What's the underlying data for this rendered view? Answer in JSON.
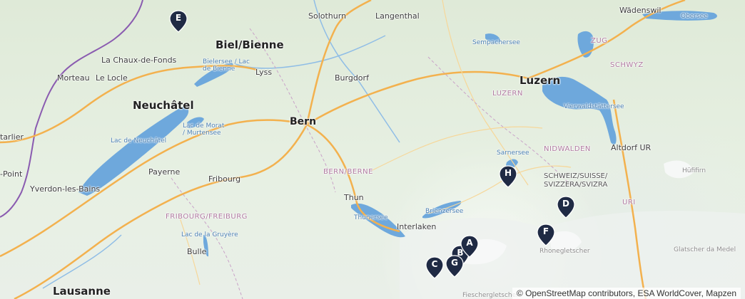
{
  "map": {
    "places": {
      "solothurn": "Solothurn",
      "langenthal": "Langenthal",
      "wadenswil": "Wädenswil",
      "obersee": "Obersee",
      "biel": "Biel/Bienne",
      "chaux": "La Chaux-de-Fonds",
      "morteau": "Morteau",
      "locle": "Le Locle",
      "bielersee": "Bielersee / Lac de Bienne",
      "lyss": "Lyss",
      "burgdorf": "Burgdorf",
      "sempachersee": "Sempachersee",
      "zug": "ZUG",
      "luzern_city": "Luzern",
      "luzern_canton": "LUZERN",
      "schwyz": "SCHWYZ",
      "neuchatel": "Neuchâtel",
      "pontarlier": "tarlier",
      "lacmorat": "Lac de Morat / Murtensee",
      "bern": "Bern",
      "vierwald": "Vierwaldstättersee",
      "lacneuchatel": "Lac de Neuchâtel",
      "payerne": "Payerne",
      "sarnersee": "Sarnersee",
      "nidwalden": "NIDWALDEN",
      "altdorf": "Altdorf UR",
      "bernberne": "BERN/BERNE",
      "point": "-Point",
      "yverdon": "Yverdon-les-Bains",
      "fribourg": "Fribourg",
      "schweiz": "SCHWEIZ/SUISSE/ SVIZZERA/SVIZRA",
      "huefifirn": "Hüfifirn",
      "thun": "Thun",
      "brienzersee": "Brienzersee",
      "uri": "URI",
      "thunersee": "Thunersee",
      "fribourg_canton": "FRIBOURG/FREIBURG",
      "interlaken": "Interlaken",
      "lacgruyere": "Lac de la Gruyère",
      "rhonegletscher": "Rhonegletscher",
      "glatscher": "Glatscher da Medel",
      "bulle": "Bulle",
      "lausanne": "Lausanne",
      "fiescher": "Fieschergletscher"
    },
    "markers": {
      "a": "A",
      "b": "B",
      "c": "C",
      "d": "D",
      "e": "E",
      "f": "F",
      "g": "G",
      "h": "H"
    },
    "marker_color": "#1f2a44",
    "attribution": "© OpenStreetMap contributors, ESA WorldCover, Mapzen"
  }
}
